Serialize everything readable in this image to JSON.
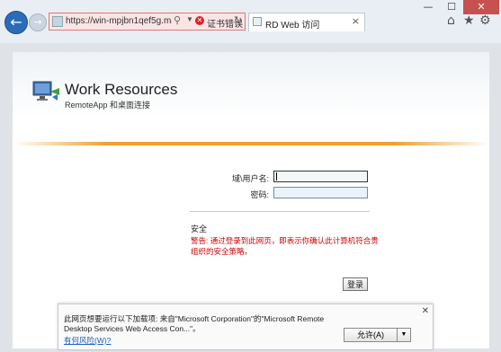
{
  "browser": {
    "url": "https://win-mpjbn1qef5g.ma...",
    "cert_error": "证书错误",
    "tab_title": "RD Web 访问",
    "window_controls": {
      "minimize": "—",
      "maximize": "☐",
      "close": "✕"
    },
    "tools": {
      "home": "⌂",
      "favorites": "★",
      "settings": "⚙"
    }
  },
  "brand": {
    "title": "Work Resources",
    "subtitle": "RemoteApp 和桌面连接"
  },
  "form": {
    "username_label": "域\\用户名:",
    "password_label": "密码:",
    "security_title": "安全",
    "security_warning": "警告: 通过登录到此网页，即表示你确认此计算机符合贵组织的安全策略。",
    "login_button": "登录"
  },
  "notification": {
    "message": "此网页想要运行以下加载项: 来自\"Microsoft Corporation\"的\"Microsoft Remote Desktop Services Web Access Con...\"。",
    "risk_link": "有何风险(W)?",
    "allow_button": "允许(A)",
    "close": "✕"
  },
  "colors": {
    "accent_orange": "#f0a030",
    "back_blue": "#2b6cb9",
    "warning_red": "#cc0000",
    "link_blue": "#1e5fbf"
  }
}
